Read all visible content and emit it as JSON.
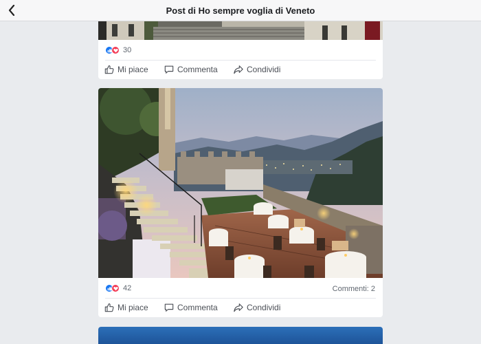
{
  "header": {
    "title": "Post di Ho sempre voglia di Veneto",
    "back_icon": "chevron-left-icon"
  },
  "posts": [
    {
      "image": "palace-courtyard-photo",
      "reactions": {
        "count": "30",
        "icons": [
          "like-icon",
          "love-icon"
        ]
      },
      "comments": "",
      "actions": {
        "like": "Mi piace",
        "comment": "Commenta",
        "share": "Condividi"
      }
    },
    {
      "image": "castle-terrace-restaurant-photo",
      "reactions": {
        "count": "42",
        "icons": [
          "like-icon",
          "love-icon"
        ]
      },
      "comments": "Commenti: 2",
      "actions": {
        "like": "Mi piace",
        "comment": "Commenta",
        "share": "Condividi"
      }
    },
    {
      "image": "sea-photo"
    }
  ],
  "colors": {
    "accent": "#1877f2",
    "love": "#f33e58",
    "background": "#e9ebee"
  }
}
